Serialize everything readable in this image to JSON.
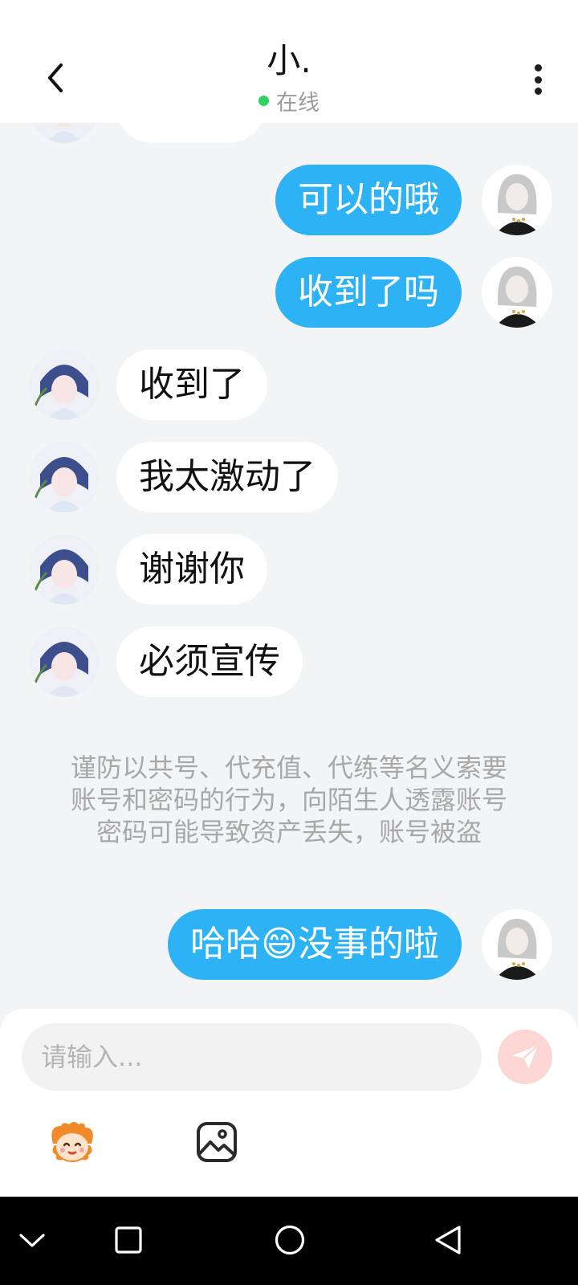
{
  "header": {
    "title": "小.",
    "status": "在线",
    "status_color": "#2dd35e"
  },
  "messages": [
    {
      "side": "in",
      "text": "",
      "partial": true
    },
    {
      "side": "out",
      "text": "可以的哦"
    },
    {
      "side": "out",
      "text": "收到了吗"
    },
    {
      "side": "in",
      "text": "收到了"
    },
    {
      "side": "in",
      "text": "我太激动了"
    },
    {
      "side": "in",
      "text": "谢谢你"
    },
    {
      "side": "in",
      "text": "必须宣传"
    },
    {
      "side": "out",
      "text": "哈哈😄没事的啦"
    }
  ],
  "notice": "谨防以共号、代充值、代练等名义索要账号和密码的行为，向陌生人透露账号密码可能导致资产丢失，账号被盗",
  "composer": {
    "placeholder": "请输入..."
  },
  "colors": {
    "outgoing_bubble": "#2db3f5",
    "incoming_bubble": "#ffffff",
    "background": "#f2f4f6",
    "send_button": "#fcd6d2"
  },
  "icons": {
    "back": "chevron-left-icon",
    "more": "more-vertical-icon",
    "send": "send-icon",
    "emoji": "emoji-mascot-icon",
    "image": "image-icon",
    "nav_back": "triangle-back-icon",
    "nav_home": "circle-home-icon",
    "nav_recent": "square-recent-icon",
    "nav_collapse": "chevron-down-icon"
  }
}
